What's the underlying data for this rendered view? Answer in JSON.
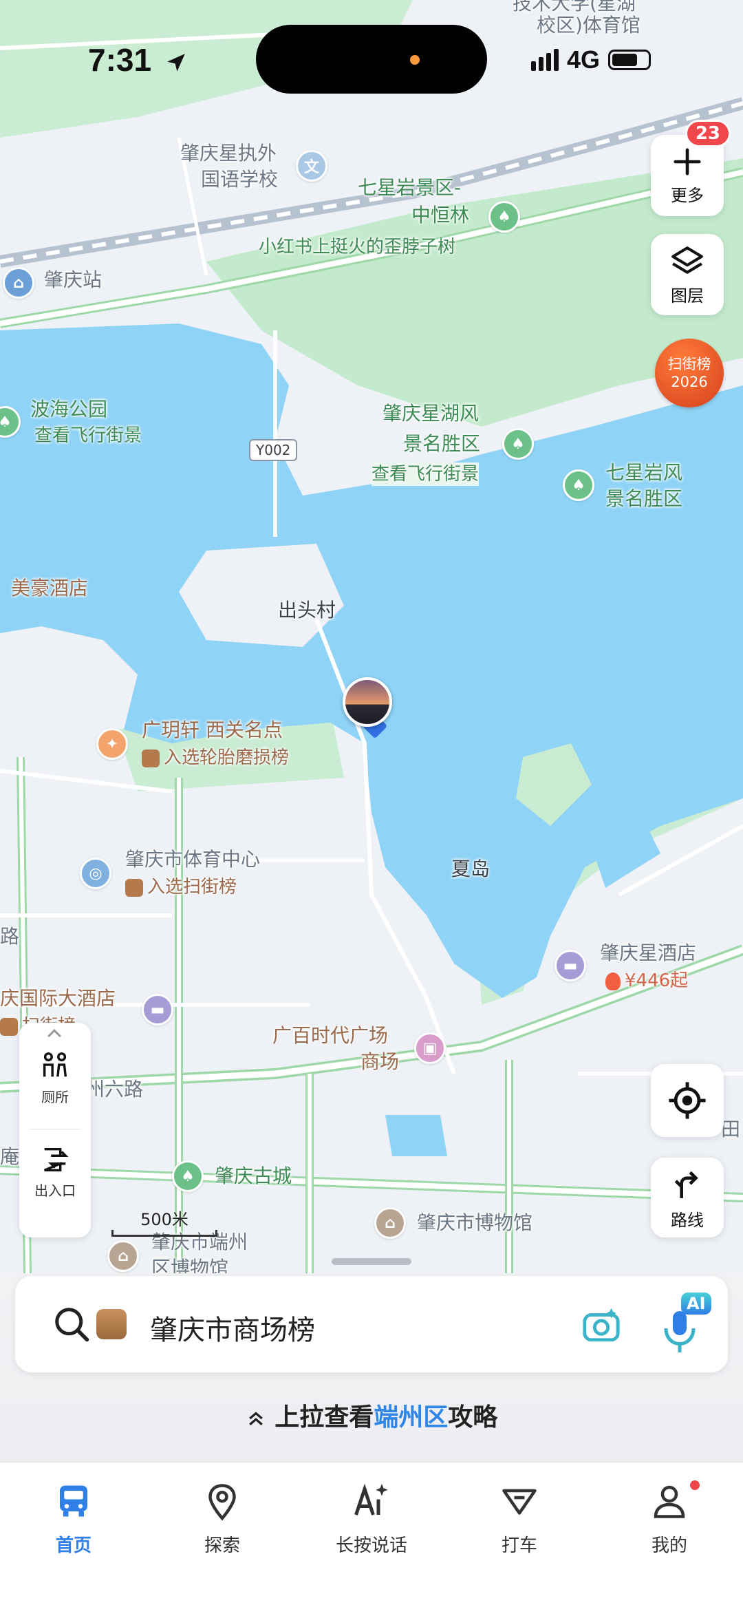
{
  "status": {
    "time": "7:31",
    "network": "4G"
  },
  "map": {
    "top_labels": [
      "技术大学(星湖",
      "校区)体育馆"
    ],
    "school": [
      "肇庆星执外",
      "国语学校"
    ],
    "scenic1": [
      "七星岩景区-",
      "中恒林"
    ],
    "scenic1_tip": "小红书上挺火的歪脖子树",
    "station": "肇庆站",
    "park": "波海公园",
    "park_link": "查看飞行街景",
    "road_tag": "Y002",
    "lake_area": [
      "肇庆星湖风",
      "景名胜区"
    ],
    "lake_link": "查看飞行街景",
    "qixing": [
      "七星岩风",
      "景名胜区"
    ],
    "hotel1": "美豪酒店",
    "village": "出头村",
    "restaurant": "广玥轩 西关名点",
    "restaurant_tag": "入选轮胎磨损榜",
    "stadium": "肇庆市体育中心",
    "stadium_tag": "入选扫街榜",
    "island": "夏岛",
    "hotel2": "肇庆星酒店",
    "hotel2_price": "¥446起",
    "hotel3": "庆国际大酒店",
    "hotel3_tag": "扫街榜",
    "mall": [
      "广百时代广场",
      "商场"
    ],
    "road": "州六路",
    "ancient_city": "肇庆古城",
    "museum": "肇庆市博物馆",
    "district_museum": [
      "肇庆市端州",
      "区博物馆"
    ],
    "edge_left": "路",
    "edge_left2": "庵",
    "edge_right": "田"
  },
  "controls": {
    "more_label": "更多",
    "more_badge": "23",
    "layers_label": "图层",
    "rank_line1": "扫街榜",
    "rank_line2": "2026",
    "toilet_label": "厕所",
    "exit_label": "出入口",
    "route_label": "路线",
    "scale_label": "500米"
  },
  "search": {
    "text": "肇庆市商场榜",
    "ai_label": "AI"
  },
  "pullup": {
    "prefix": "上拉查看",
    "highlight": "端州区",
    "suffix": "攻略"
  },
  "tabs": [
    {
      "label": "首页"
    },
    {
      "label": "探索"
    },
    {
      "label": "长按说话"
    },
    {
      "label": "打车"
    },
    {
      "label": "我的"
    }
  ],
  "colors": {
    "water": "#8fd3f6",
    "green": "#bfe8c8",
    "accent": "#2f7fe6"
  }
}
